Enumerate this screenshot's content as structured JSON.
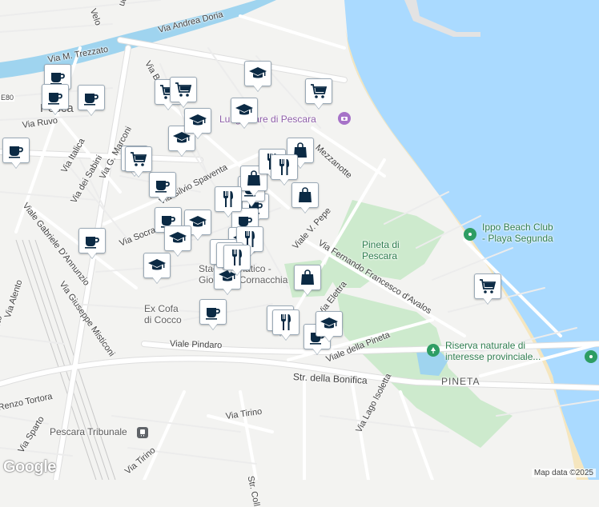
{
  "map": {
    "colors": {
      "land": "#f3f3f1",
      "sea": "#aadaff",
      "beach": "#f5e9c8",
      "park": "#cdeacd",
      "river": "#9fd4ef",
      "road": "#ffffff",
      "road_outline": "#dedede",
      "marker_icon": "#0b2a44"
    },
    "street_labels": [
      {
        "id": "via-andrea-doria",
        "text": "Via Andrea Doria"
      },
      {
        "id": "via-trezzato",
        "text": "Via M. Trezzato"
      },
      {
        "id": "via-ruvo",
        "text": "Via Ruvo"
      },
      {
        "id": "via-italica",
        "text": "Via Italica"
      },
      {
        "id": "via-dei-sabini",
        "text": "Via dei Sabini"
      },
      {
        "id": "viale-gabriele",
        "text": "Viale Gabriele D'Annunzio"
      },
      {
        "id": "via-giuseppe-misticoni",
        "text": "Via Giuseppe Misticoni"
      },
      {
        "id": "via-alento",
        "text": "Via Alento"
      },
      {
        "id": "via-socrate",
        "text": "Via Socrate"
      },
      {
        "id": "via-silvio-spaventa",
        "text": "Via Silvio Spaventa"
      },
      {
        "id": "via-chiarcon",
        "text": "Via G. Marconi"
      },
      {
        "id": "viale-v-pepe",
        "text": "Viale V. Pepe"
      },
      {
        "id": "via-fernando",
        "text": "Via Fernando Francesco d'Avalos"
      },
      {
        "id": "via-elettra",
        "text": "Via Elettra"
      },
      {
        "id": "viale-della-pineta",
        "text": "Viale della Pineta"
      },
      {
        "id": "viale-pindaro",
        "text": "Viale Pindaro"
      },
      {
        "id": "str-della-bonifica",
        "text": "Str. della Bonifica"
      },
      {
        "id": "via-tirino",
        "text": "Via Tirino"
      },
      {
        "id": "via-tirino-2",
        "text": "Via Tirino"
      },
      {
        "id": "via-lago-isoletta",
        "text": "Via Lago Isoletta"
      },
      {
        "id": "via-sparto",
        "text": "Via Sparto"
      },
      {
        "id": "via-tortora",
        "text": "Renzo Tortora"
      },
      {
        "id": "via-mezzanotte",
        "text": "Mezzanotte"
      },
      {
        "id": "via-barn",
        "text": "Via Ba"
      },
      {
        "id": "via-velo",
        "text": "Velo"
      },
      {
        "id": "via-ucini",
        "text": "ucini"
      },
      {
        "id": "via-osto",
        "text": "osto"
      },
      {
        "id": "str-coll",
        "text": "Str. Coll"
      },
      {
        "id": "e80",
        "text": "E80"
      }
    ],
    "places": [
      {
        "id": "pineta-di-pescara",
        "text": "Pineta di\nPescara",
        "kind": "park"
      },
      {
        "id": "pineta-district",
        "text": "PINETA",
        "kind": "district"
      },
      {
        "id": "pescara-city",
        "text": "Pesca",
        "kind": "place"
      },
      {
        "id": "stadio",
        "text": "Stadio Adriatico -\nGiovanni Cornacchia",
        "kind": "dark"
      },
      {
        "id": "ex-cofa",
        "text": "Ex Cofa\ndi Cocco",
        "kind": "dark"
      },
      {
        "id": "lungomare",
        "text": "Lungomare di Pescara",
        "kind": "poi-purple"
      },
      {
        "id": "ippo-beach",
        "text": "Ippo Beach Club\n- Playa Segunda",
        "kind": "poi-green"
      },
      {
        "id": "riserva",
        "text": "Riserva naturale di\ninteresse provinciale...",
        "kind": "poi-green"
      },
      {
        "id": "pescara-tribunale",
        "text": "Pescara Tribunale",
        "kind": "place"
      }
    ],
    "markers": [
      {
        "icon": "coffee"
      },
      {
        "icon": "coffee"
      },
      {
        "icon": "coffee"
      },
      {
        "icon": "coffee"
      },
      {
        "icon": "coffee"
      },
      {
        "icon": "coffee"
      },
      {
        "icon": "coffee"
      },
      {
        "icon": "coffee"
      },
      {
        "icon": "coffee"
      },
      {
        "icon": "coffee"
      },
      {
        "icon": "coffee"
      },
      {
        "icon": "coffee"
      },
      {
        "icon": "cart"
      },
      {
        "icon": "cart"
      },
      {
        "icon": "cart"
      },
      {
        "icon": "cart"
      },
      {
        "icon": "cart"
      },
      {
        "icon": "cart"
      },
      {
        "icon": "school"
      },
      {
        "icon": "school"
      },
      {
        "icon": "school"
      },
      {
        "icon": "school"
      },
      {
        "icon": "school"
      },
      {
        "icon": "school"
      },
      {
        "icon": "school"
      },
      {
        "icon": "school"
      },
      {
        "icon": "school"
      },
      {
        "icon": "school"
      },
      {
        "icon": "bag"
      },
      {
        "icon": "bag"
      },
      {
        "icon": "bag"
      },
      {
        "icon": "bag"
      },
      {
        "icon": "food"
      },
      {
        "icon": "food"
      },
      {
        "icon": "food"
      },
      {
        "icon": "food"
      },
      {
        "icon": "food"
      },
      {
        "icon": "food"
      },
      {
        "icon": "food"
      },
      {
        "icon": "food"
      },
      {
        "icon": "food"
      }
    ],
    "attribution": "Map data ©2025",
    "logo": "Google"
  }
}
